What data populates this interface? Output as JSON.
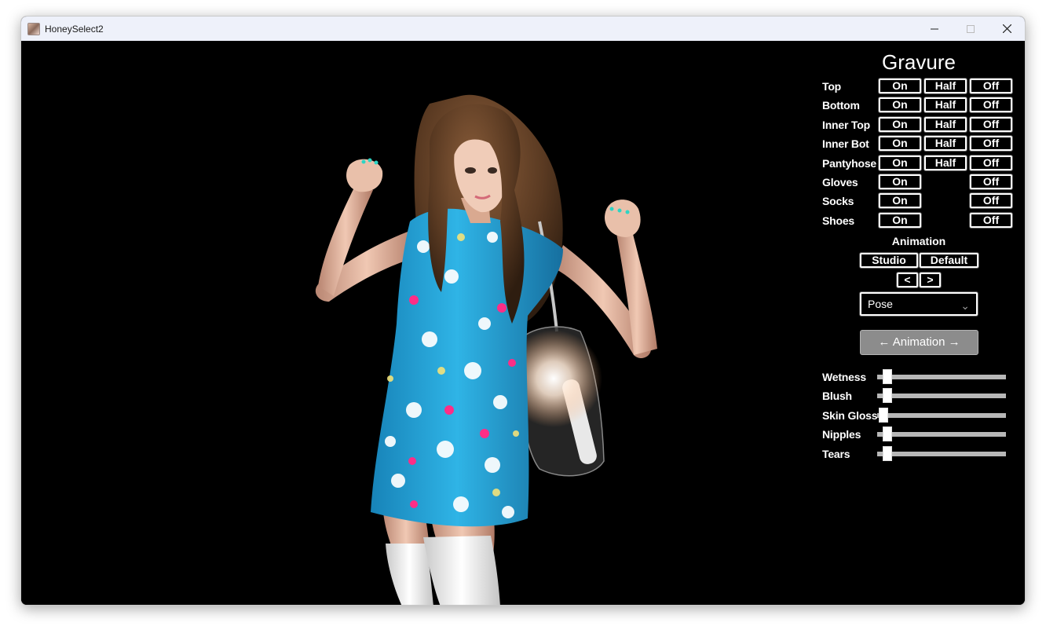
{
  "window": {
    "title": "HoneySelect2"
  },
  "panel": {
    "title": "Gravure",
    "clothes": [
      {
        "label": "Top",
        "on": "On",
        "half": "Half",
        "off": "Off"
      },
      {
        "label": "Bottom",
        "on": "On",
        "half": "Half",
        "off": "Off"
      },
      {
        "label": "Inner Top",
        "on": "On",
        "half": "Half",
        "off": "Off"
      },
      {
        "label": "Inner Bot",
        "on": "On",
        "half": "Half",
        "off": "Off"
      },
      {
        "label": "Pantyhose",
        "on": "On",
        "half": "Half",
        "off": "Off"
      },
      {
        "label": "Gloves",
        "on": "On",
        "half": null,
        "off": "Off"
      },
      {
        "label": "Socks",
        "on": "On",
        "half": null,
        "off": "Off"
      },
      {
        "label": "Shoes",
        "on": "On",
        "half": null,
        "off": "Off"
      }
    ],
    "animation": {
      "label": "Animation",
      "studio": "Studio",
      "default": "Default",
      "prev": "<",
      "next": ">",
      "pose_selected": "Pose",
      "toggle": "← Animation →"
    },
    "sliders": [
      {
        "label": "Wetness",
        "value": 0.03
      },
      {
        "label": "Blush",
        "value": 0.03
      },
      {
        "label": "Skin Gloss",
        "value": 0.0
      },
      {
        "label": "Nipples",
        "value": 0.03
      },
      {
        "label": "Tears",
        "value": 0.03
      }
    ]
  },
  "colors": {
    "dress": "#27a9de",
    "hair": "#5a3a22",
    "skin": "#e8bfa8",
    "socks": "#efefef",
    "nails": "#2dd4c4",
    "flower_pink": "#ff2d86",
    "flower_white": "#ffffff",
    "flower_yellow": "#f3e27a"
  }
}
